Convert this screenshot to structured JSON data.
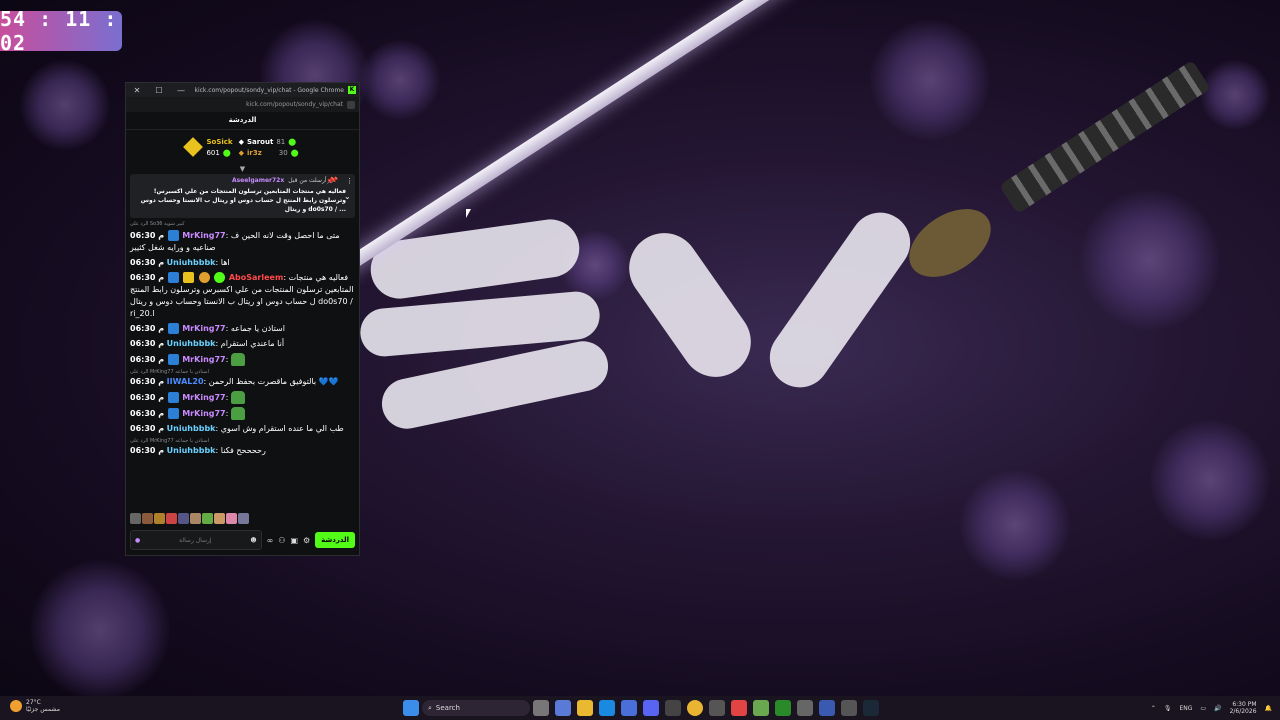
{
  "overlay_clock": "54 : 11 : 02",
  "window": {
    "title": "kick.com/popout/sondy_vip/chat - Google Chrome",
    "url": "kick.com/popout/sondy_vip/chat",
    "close": "✕",
    "maximize": "☐",
    "minimize": "—"
  },
  "chat": {
    "header": "الدردشة",
    "leaderboard": [
      {
        "name": "SoSick",
        "value": "601"
      },
      {
        "name": "Sarout",
        "value": "81"
      },
      {
        "name": "ir3z",
        "value": "30"
      }
    ],
    "pinned": {
      "label": "أرسلت من قبل",
      "user": "Aseelgamer72x",
      "text": "!فعاليه هي منتجات المتابعين ترسلون المنتجات من علي اكسبرس وترسلون رابط المنتج ل حساب دوس او ريتال ب الانستا وحساب دوس و ريتال do0s70 / ..."
    },
    "messages": [
      {
        "reply": "الرد على So36 كبير شوية",
        "time": "06:30 م",
        "user": "MrKing77",
        "color": "#c88bff",
        "text": "متى ما احصل وقت لانه الحين ف صناعيه و ورايه شغل كثيير"
      },
      {
        "time": "06:30 م",
        "user": "Uniuhbbbk",
        "color": "#6ad1ff",
        "text": "اها"
      },
      {
        "time": "06:30 م",
        "user": "AboSarleem",
        "color": "#ff4a4a",
        "text": "فعاليه هي منتجات المتابعين ترسلون المنتجات من علي اكسبرس وترسلون رابط المنتج ل حساب دوس او ريتال ب الانستا وحساب دوس و ريتال do0s70 / ri_20.l"
      },
      {
        "time": "06:30 م",
        "user": "MrKing77",
        "color": "#c88bff",
        "text": "استاذن يا جماعه"
      },
      {
        "time": "06:30 م",
        "user": "Uniuhbbbk",
        "color": "#6ad1ff",
        "text": "أنا ماعندي استقرام"
      },
      {
        "time": "06:30 م",
        "user": "MrKing77",
        "color": "#c88bff",
        "text": ""
      },
      {
        "reply": "الرد على MrKing77 استاذن يا جماعه",
        "time": "06:30 م",
        "user": "IIWAL20",
        "color": "#4a8cff",
        "text": "بالتوفيق ماقصرت بحفظ الرحمن 💙💙"
      },
      {
        "time": "06:30 م",
        "user": "MrKing77",
        "color": "#c88bff",
        "text": ""
      },
      {
        "time": "06:30 م",
        "user": "MrKing77",
        "color": "#c88bff",
        "text": ""
      },
      {
        "time": "06:30 م",
        "user": "Uniuhbbbk",
        "color": "#6ad1ff",
        "text": "طب الي ما عنده استقرام وش اسوي"
      },
      {
        "reply": "الرد على MrKing77 استاذن يا جماعه",
        "time": "06:30 م",
        "user": "Uniuhbbbk",
        "color": "#6ad1ff",
        "text": "رححححح فكنا"
      }
    ],
    "input_placeholder": "إرسال رسالة",
    "send_label": "الدردشة"
  },
  "taskbar": {
    "weather_temp": "27°C",
    "weather_desc": "مشمس جزئيًا",
    "search_label": "Search",
    "lang": "ENG",
    "time": "6:30 PM",
    "date": "2/6/2026"
  },
  "colors": {
    "kick_green": "#53fc18"
  }
}
